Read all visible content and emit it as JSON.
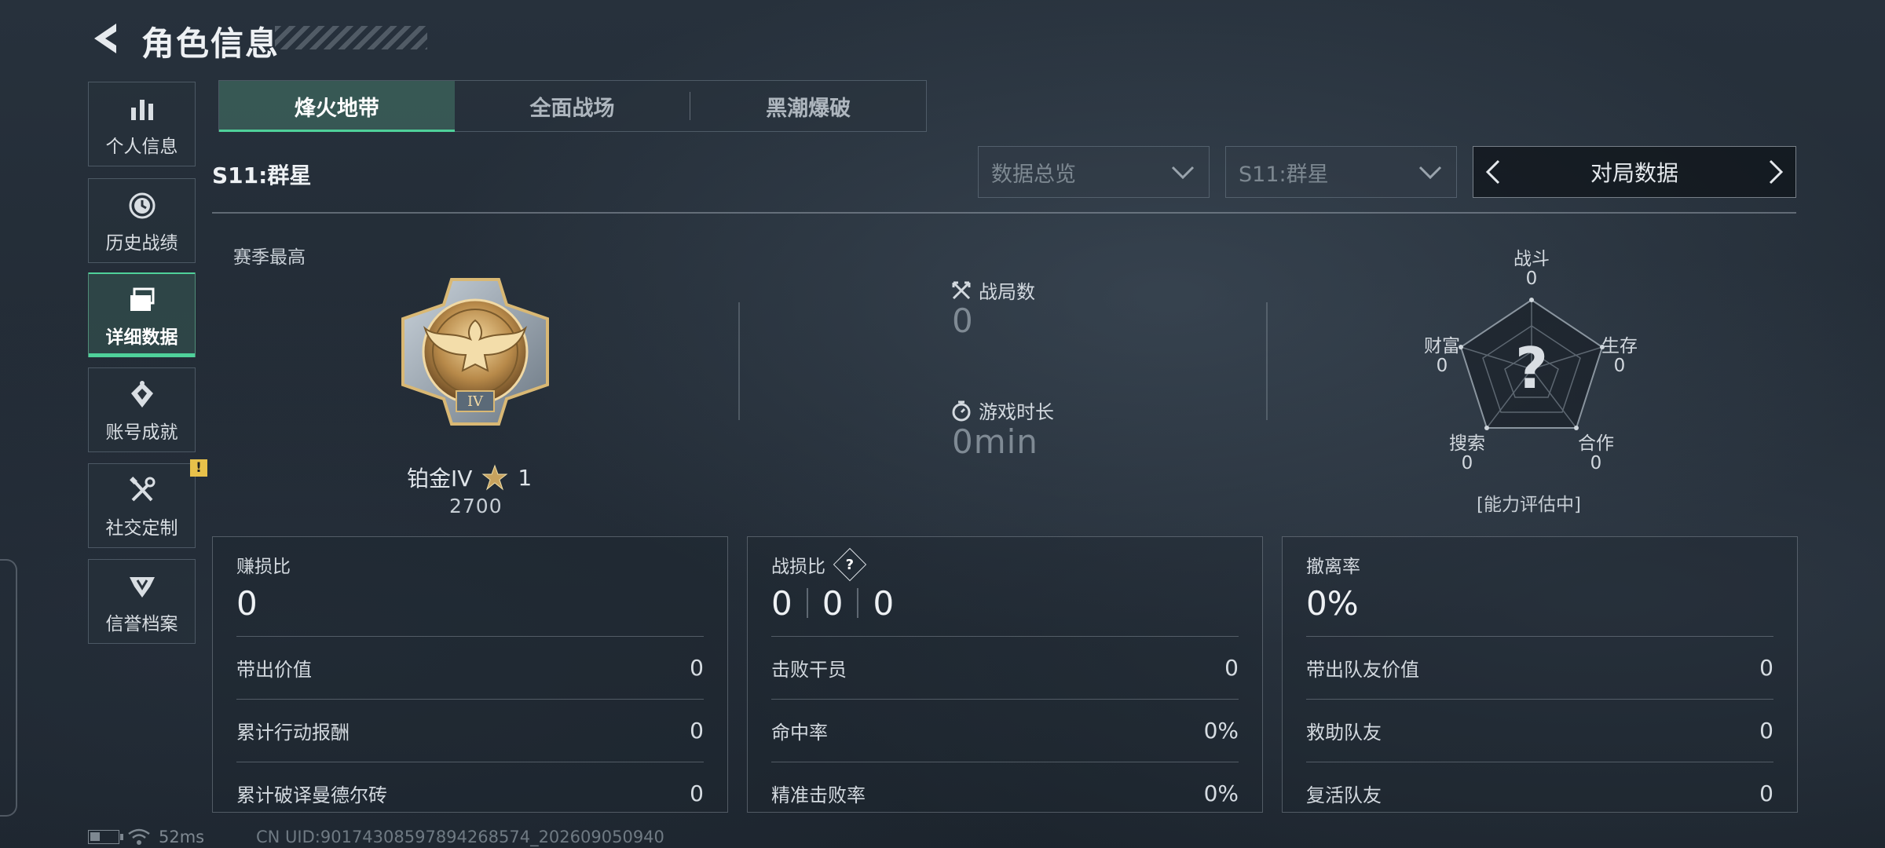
{
  "header": {
    "title": "角色信息"
  },
  "sidebar": {
    "items": [
      {
        "label": "个人信息",
        "icon": "bar-chart-icon"
      },
      {
        "label": "历史战绩",
        "icon": "history-clock-icon"
      },
      {
        "label": "详细数据",
        "icon": "folders-icon",
        "active": true
      },
      {
        "label": "账号成就",
        "icon": "achievement-icon"
      },
      {
        "label": "社交定制",
        "icon": "tools-icon",
        "badge": "!"
      },
      {
        "label": "信誉档案",
        "icon": "credibility-icon"
      }
    ]
  },
  "tabs": [
    {
      "label": "烽火地带",
      "active": true
    },
    {
      "label": "全面战场"
    },
    {
      "label": "黑潮爆破"
    }
  ],
  "season": {
    "title": "S11:群星"
  },
  "filters": {
    "data_type": "数据总览",
    "season": "S11:群星",
    "switcher": "对局数据"
  },
  "rank": {
    "label": "赛季最高",
    "tier": "铂金IV",
    "stars": "1",
    "score": "2700",
    "medal_roman": "IV"
  },
  "overview": {
    "matches_label": "战局数",
    "matches_value": "0",
    "playtime_label": "游戏时长",
    "playtime_value": "0min"
  },
  "radar": {
    "center": "?",
    "combat_label": "战斗",
    "combat_value": "0",
    "survival_label": "生存",
    "survival_value": "0",
    "teamwork_label": "合作",
    "teamwork_value": "0",
    "search_label": "搜索",
    "search_value": "0",
    "wealth_label": "财富",
    "wealth_value": "0",
    "status": "[能力评估中]"
  },
  "panels": {
    "profit": {
      "title": "赚损比",
      "value": "0",
      "rows": [
        {
          "label": "带出价值",
          "value": "0"
        },
        {
          "label": "累计行动报酬",
          "value": "0"
        },
        {
          "label": "累计破译曼德尔砖",
          "value": "0"
        }
      ]
    },
    "kd": {
      "title": "战损比",
      "help": "?",
      "values": [
        "0",
        "0",
        "0"
      ],
      "rows": [
        {
          "label": "击败干员",
          "value": "0"
        },
        {
          "label": "命中率",
          "value": "0%"
        },
        {
          "label": "精准击败率",
          "value": "0%"
        }
      ]
    },
    "extract": {
      "title": "撤离率",
      "value": "0%",
      "rows": [
        {
          "label": "带出队友价值",
          "value": "0"
        },
        {
          "label": "救助队友",
          "value": "0"
        },
        {
          "label": "复活队友",
          "value": "0"
        }
      ]
    }
  },
  "footer": {
    "ping": "52ms",
    "uid": "CN UID:90174308597894268574_202609050940"
  },
  "colors": {
    "accent": "#4fd19a",
    "badge": "#e8c14a"
  }
}
